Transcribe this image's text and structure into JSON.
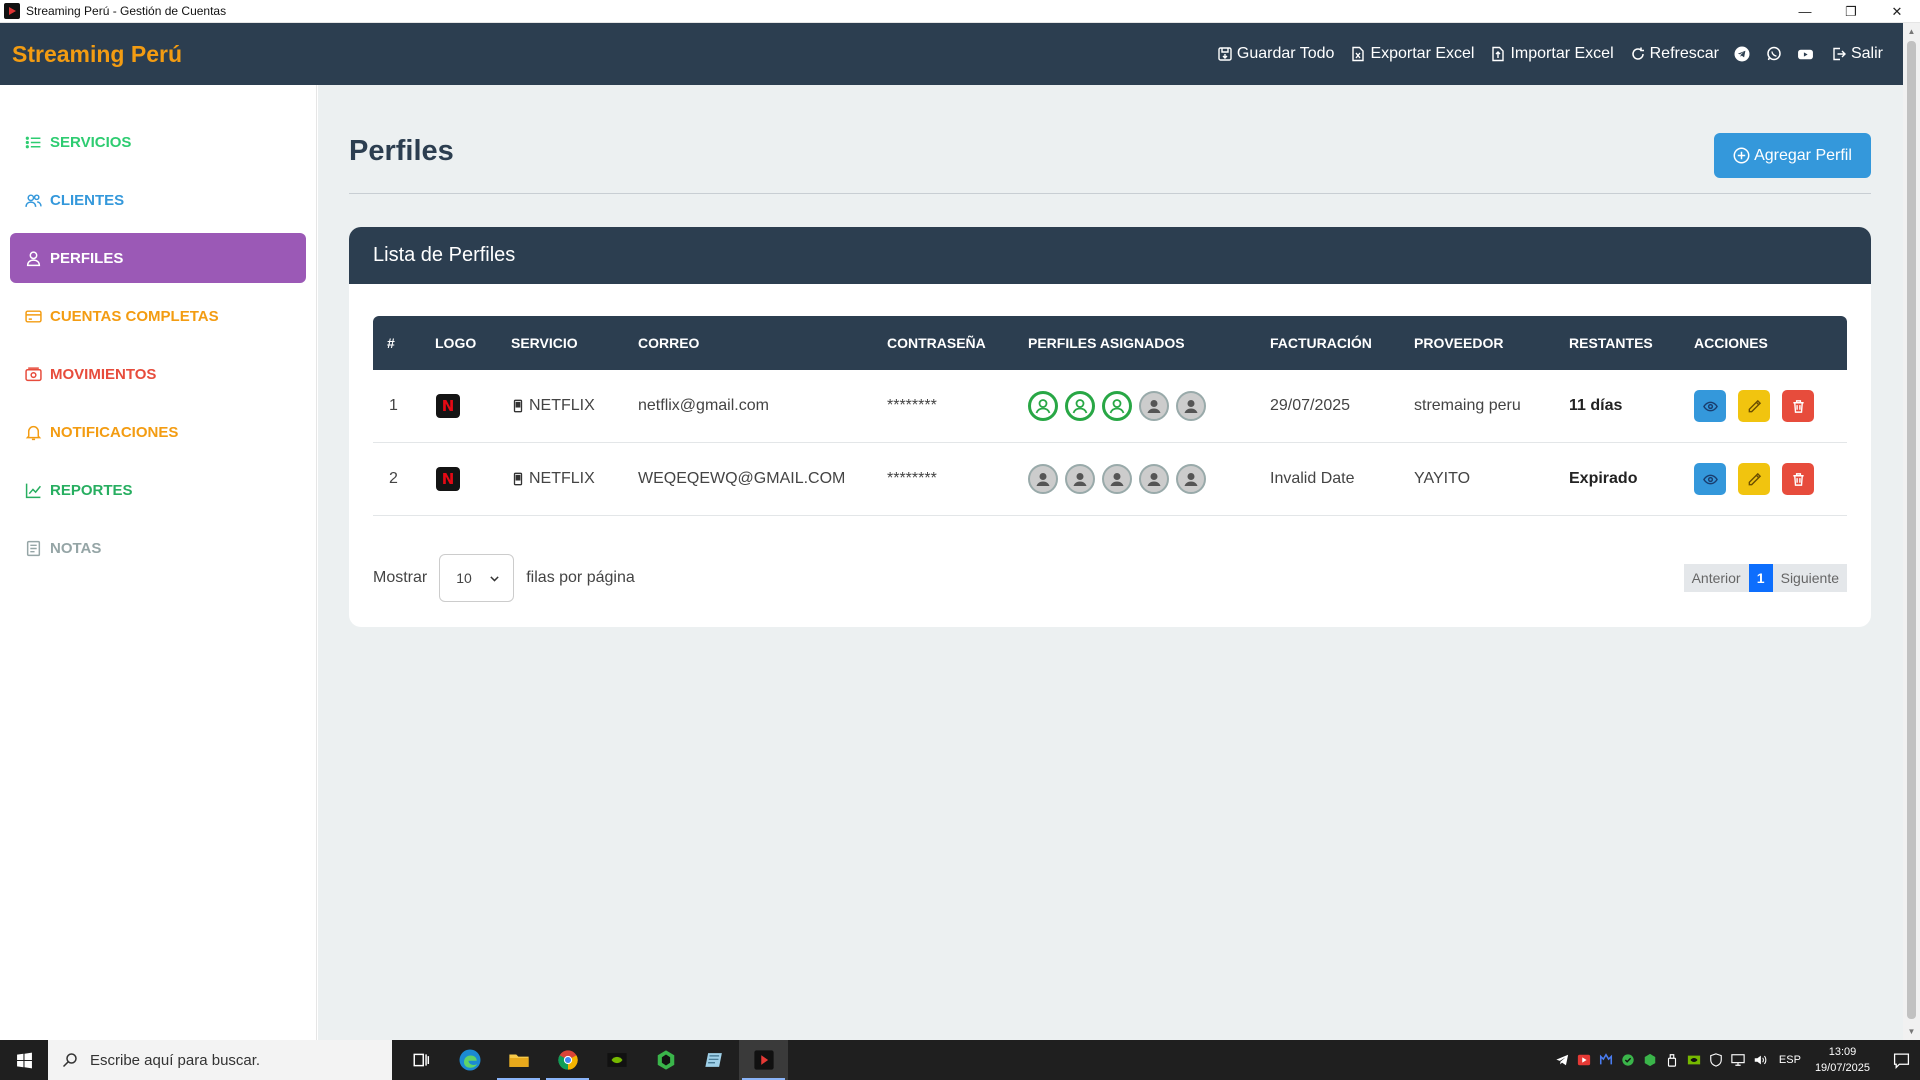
{
  "window": {
    "title": "Streaming Perú - Gestión de Cuentas",
    "controls": [
      "—",
      "❐",
      "✕"
    ]
  },
  "header": {
    "brand": "Streaming Perú",
    "brand_color": "#f39c12",
    "bg_color": "#2c3e50",
    "actions": [
      {
        "label": "Guardar Todo",
        "icon": "save-icon"
      },
      {
        "label": "Exportar Excel",
        "icon": "file-excel-icon"
      },
      {
        "label": "Importar Excel",
        "icon": "file-import-icon"
      },
      {
        "label": "Refrescar",
        "icon": "refresh-icon"
      }
    ],
    "social_icons": [
      "telegram-icon",
      "whatsapp-icon",
      "youtube-icon"
    ],
    "logout_label": "Salir"
  },
  "sidebar": {
    "items": [
      {
        "label": "SERVICIOS",
        "icon": "list-icon",
        "color": "#2ecc71"
      },
      {
        "label": "CLIENTES",
        "icon": "users-icon",
        "color": "#3498db"
      },
      {
        "label": "PERFILES",
        "icon": "user-icon",
        "color": "#ffffff",
        "active": true
      },
      {
        "label": "CUENTAS COMPLETAS",
        "icon": "credit-card-icon",
        "color": "#f39c12"
      },
      {
        "label": "MOVIMIENTOS",
        "icon": "cash-icon",
        "color": "#e74c3c"
      },
      {
        "label": "NOTIFICACIONES",
        "icon": "bell-icon",
        "color": "#f39c12"
      },
      {
        "label": "REPORTES",
        "icon": "chart-line-icon",
        "color": "#27ae60"
      },
      {
        "label": "NOTAS",
        "icon": "notes-icon",
        "color": "#95a5a6"
      }
    ],
    "active_color": "#9b59b6"
  },
  "main": {
    "title": "Perfiles",
    "add_button": "Agregar Perfil",
    "card_title": "Lista de Perfiles",
    "columns": [
      "#",
      "LOGO",
      "SERVICIO",
      "CORREO",
      "CONTRASEÑA",
      "PERFILES ASIGNADOS",
      "FACTURACIÓN",
      "PROVEEDOR",
      "RESTANTES",
      "ACCIONES"
    ],
    "rows": [
      {
        "num": "1",
        "logo": "N",
        "service": "NETFLIX",
        "email": "netflix@gmail.com",
        "password": "********",
        "profiles": [
          true,
          true,
          true,
          false,
          false
        ],
        "billing": "29/07/2025",
        "provider": "stremaing peru",
        "remaining": "11 días"
      },
      {
        "num": "2",
        "logo": "N",
        "service": "NETFLIX",
        "email": "WEQEQEWQ@GMAIL.COM",
        "password": "********",
        "profiles": [
          false,
          false,
          false,
          false,
          false
        ],
        "billing": "Invalid Date",
        "provider": "YAYITO",
        "remaining": "Expirado"
      }
    ],
    "show_label": "Mostrar",
    "rows_per_page": "10",
    "rows_suffix": "filas por página",
    "pager": {
      "prev": "Anterior",
      "current": "1",
      "next": "Siguiente"
    }
  },
  "taskbar": {
    "search_placeholder": "Escribe aquí para buscar.",
    "apps": [
      "task-view-icon",
      "edge-icon",
      "file-explorer-icon",
      "chrome-icon",
      "nvidia-icon",
      "app-green-icon",
      "app-notes-icon",
      "streaming-app-icon"
    ],
    "language": "ESP",
    "time": "13:09",
    "date": "19/07/2025"
  }
}
